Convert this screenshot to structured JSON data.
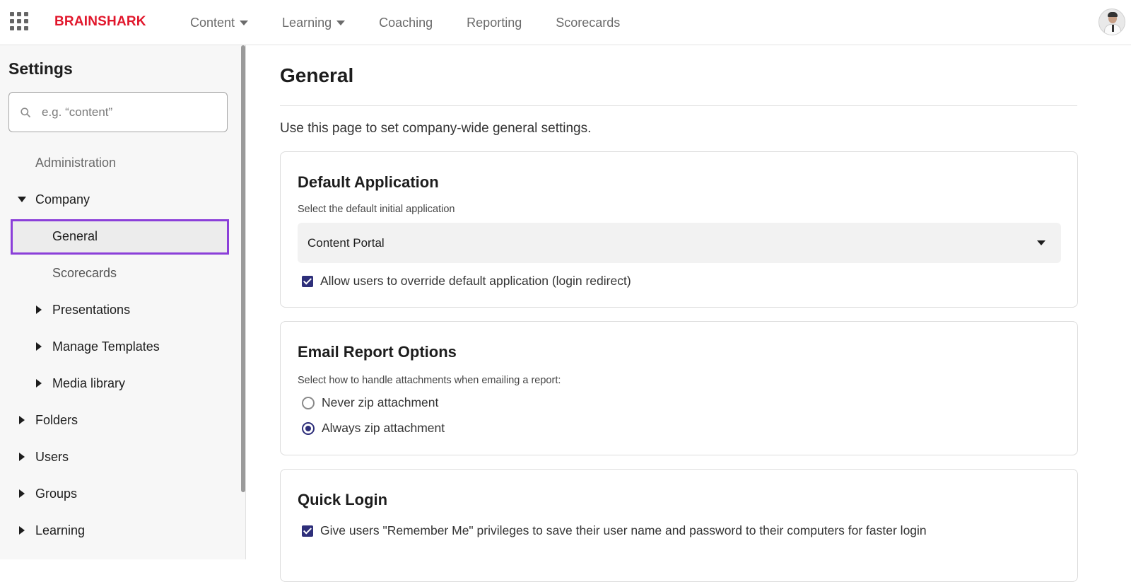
{
  "topbar": {
    "logo": "BRAINSHARK",
    "nav": [
      {
        "label": "Content",
        "dropdown": true
      },
      {
        "label": "Learning",
        "dropdown": true
      },
      {
        "label": "Coaching",
        "dropdown": false
      },
      {
        "label": "Reporting",
        "dropdown": false
      },
      {
        "label": "Scorecards",
        "dropdown": false
      }
    ]
  },
  "sidebar": {
    "title": "Settings",
    "search_placeholder": "e.g. “content”",
    "items": [
      {
        "label": "Administration",
        "arrow": "none"
      },
      {
        "label": "Company",
        "arrow": "down"
      },
      {
        "label": "General",
        "arrow": "none",
        "selected": true
      },
      {
        "label": "Scorecards",
        "arrow": "none"
      },
      {
        "label": "Presentations",
        "arrow": "right"
      },
      {
        "label": "Manage Templates",
        "arrow": "right"
      },
      {
        "label": "Media library",
        "arrow": "right"
      },
      {
        "label": "Folders",
        "arrow": "right"
      },
      {
        "label": "Users",
        "arrow": "right"
      },
      {
        "label": "Groups",
        "arrow": "right"
      },
      {
        "label": "Learning",
        "arrow": "right"
      }
    ]
  },
  "main": {
    "title": "General",
    "intro": "Use this page to set company-wide general settings.",
    "default_app": {
      "title": "Default Application",
      "subtitle": "Select the default initial application",
      "selected_value": "Content Portal",
      "override_label": "Allow users to override default application (login redirect)",
      "override_checked": true
    },
    "email_report": {
      "title": "Email Report Options",
      "subtitle": "Select how to handle attachments when emailing a report:",
      "options": [
        {
          "label": "Never zip attachment",
          "selected": false
        },
        {
          "label": "Always zip attachment",
          "selected": true
        }
      ]
    },
    "quick_login": {
      "title": "Quick Login",
      "remember_label": "Give users \"Remember Me\" privileges to save their user name and password to their computers for faster login",
      "remember_checked": true
    }
  },
  "colors": {
    "brand": "#e1162b",
    "selection_outline": "#8b3fd9",
    "control_accent": "#2e2f7a"
  }
}
